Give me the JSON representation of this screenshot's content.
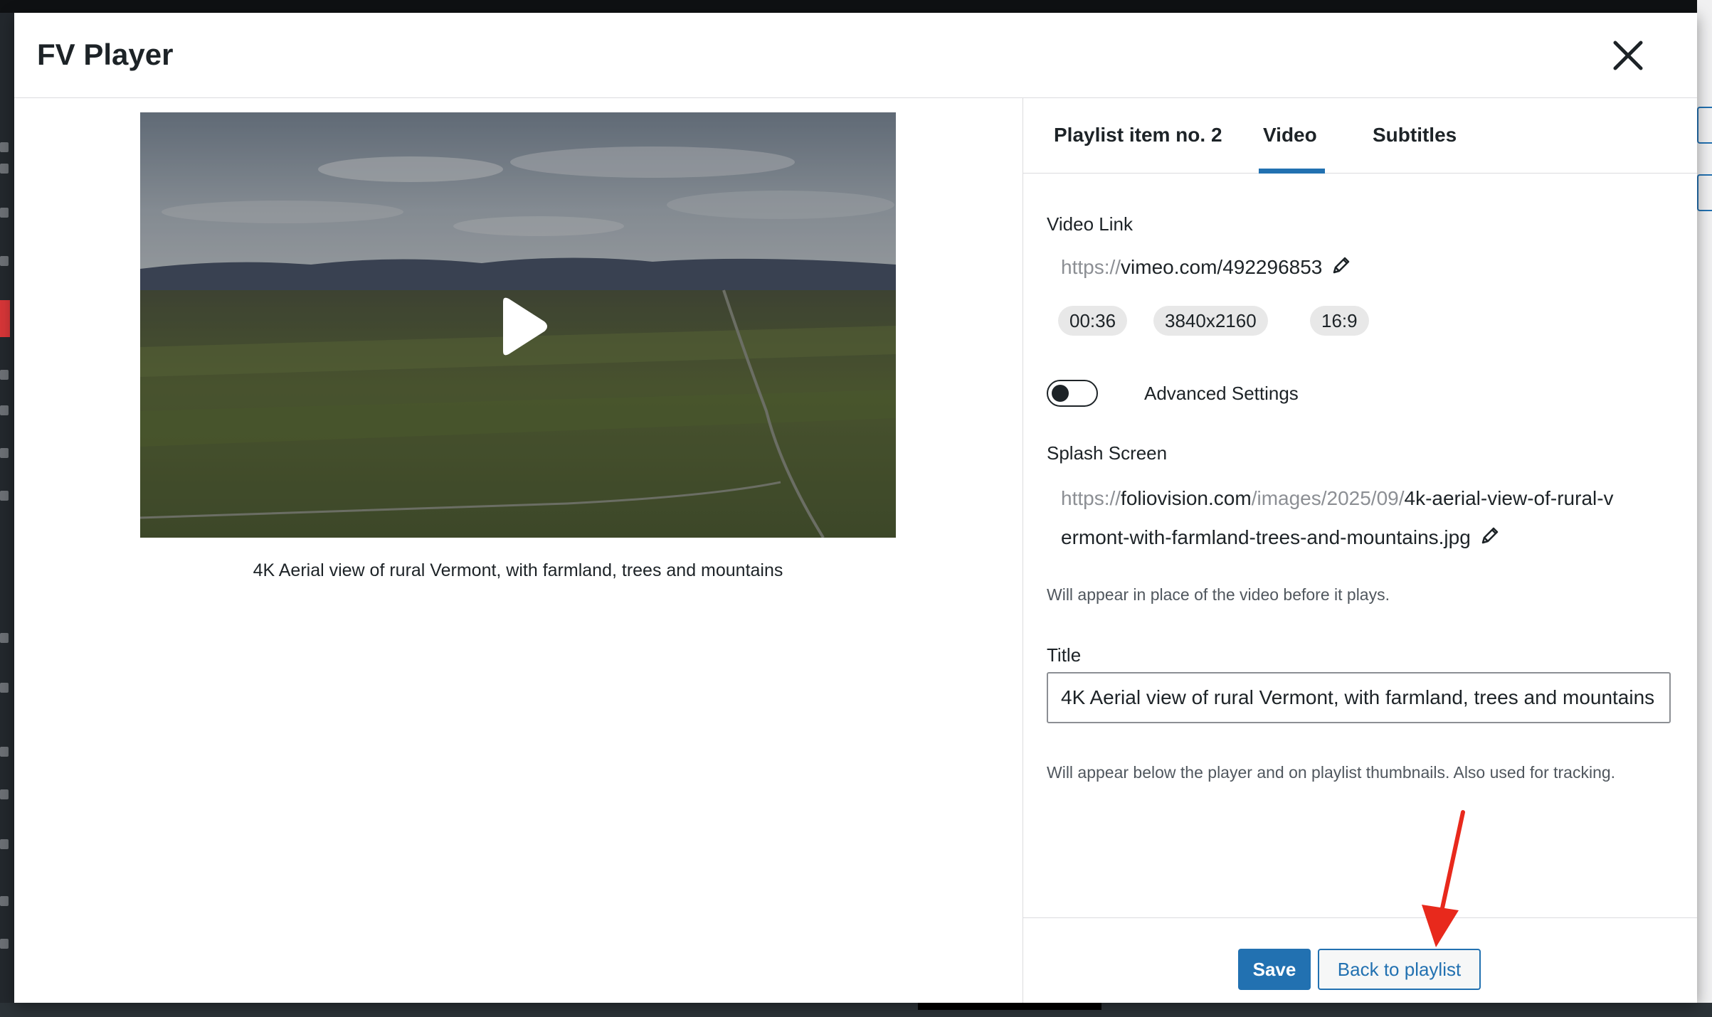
{
  "modal": {
    "title": "FV Player"
  },
  "video": {
    "caption": "4K Aerial view of rural Vermont, with farmland, trees and mountains"
  },
  "tabs": [
    {
      "label": "Playlist item no. 2",
      "active": false
    },
    {
      "label": "Video",
      "active": true
    },
    {
      "label": "Subtitles",
      "active": false
    }
  ],
  "video_link": {
    "label": "Video Link",
    "url_prefix": "https://",
    "url_main": "vimeo.com/",
    "url_id": "492296853",
    "duration": "00:36",
    "resolution": "3840x2160",
    "aspect": "16:9"
  },
  "advanced": {
    "label": "Advanced Settings",
    "enabled": false
  },
  "splash": {
    "label": "Splash Screen",
    "url_prefix": "https://",
    "url_domain": "foliovision.com",
    "url_path": "/images/2025/09/",
    "url_file_line1": "4k-aerial-view-of-rural-v",
    "url_file_line2": "ermont-with-farmland-trees-and-mountains.jpg",
    "help": "Will appear in place of the video before it plays."
  },
  "title_field": {
    "label": "Title",
    "value": "4K Aerial view of rural Vermont, with farmland, trees and mountains",
    "help": "Will appear below the player and on playlist thumbnails. Also used for tracking."
  },
  "footer": {
    "save_label": "Save",
    "back_label": "Back to playlist"
  },
  "colors": {
    "accent": "#2271b1",
    "arrow": "#e8291c"
  }
}
